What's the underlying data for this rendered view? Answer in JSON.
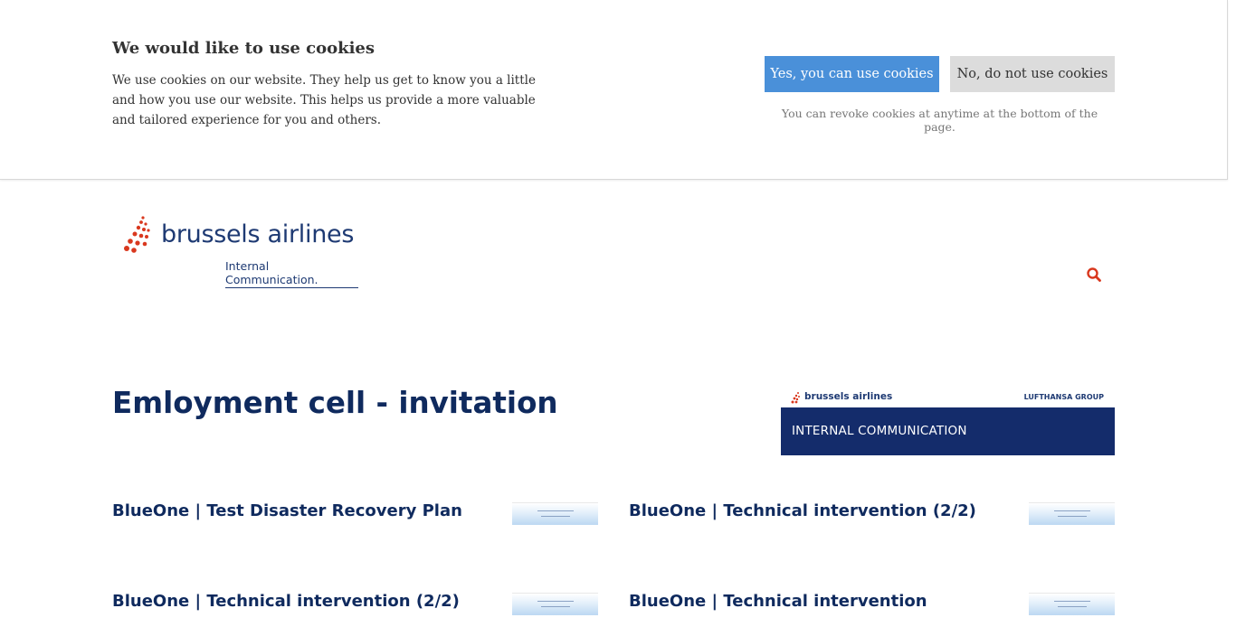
{
  "cookie_banner": {
    "title": "We would like to use cookies",
    "text": "We use cookies on our website. They help us get to know you a little and how you use our website. This helps us provide a more valuable and tailored experience for you and others.",
    "accept_label": "Yes, you can use cookies",
    "decline_label": "No, do not use cookies",
    "note": "You can revoke cookies at anytime at the bottom of the page."
  },
  "header": {
    "logo_text": "brussels airlines",
    "logo_subtext": "Internal Communication.",
    "search_icon": "search-icon"
  },
  "main": {
    "title": "Emloyment cell - invitation",
    "banner": {
      "brand": "brussels airlines",
      "group": "LUFTHANSA GROUP",
      "label": "INTERNAL COMMUNICATION"
    },
    "articles": [
      {
        "title": "BlueOne | Test Disaster Recovery Plan"
      },
      {
        "title": "BlueOne | Technical intervention (2/2)"
      },
      {
        "title": "BlueOne | Technical intervention (2/2)"
      },
      {
        "title": "BlueOne | Technical intervention"
      }
    ]
  },
  "colors": {
    "accent_blue": "#4a90d9",
    "navy": "#0f2a5e",
    "brand_red": "#d9381e",
    "banner_navy": "#142c6b"
  }
}
